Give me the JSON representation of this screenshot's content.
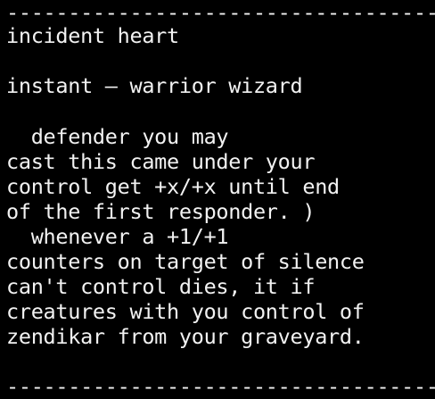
{
  "terminal": {
    "separator_top": "-----------------------------------",
    "card_name": "incident heart",
    "type_line": "instant — warrior wizard",
    "rules_text": [
      "  defender you may",
      "cast this came under your",
      "control get +x/+x until end",
      "of the first responder. )",
      "  whenever a +1/+1",
      "counters on target of silence",
      "can't control dies, it if",
      "creatures with you control of",
      "zendikar from your graveyard."
    ],
    "separator_bottom": "-----------------------------------"
  },
  "colors": {
    "background": "#000000",
    "text": "#f2f2f2"
  }
}
